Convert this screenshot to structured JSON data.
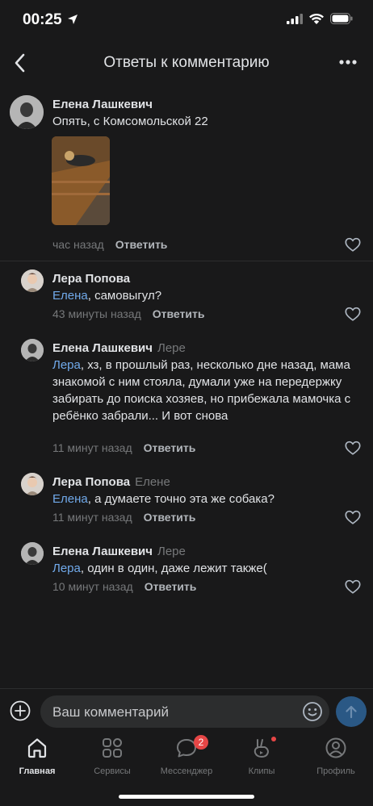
{
  "status": {
    "time": "00:25"
  },
  "nav": {
    "title": "Ответы к комментарию",
    "back_icon": "chevron-left-icon",
    "more_icon": "more-horizontal-icon"
  },
  "root_comment": {
    "author": "Елена Лашкевич",
    "text": "Опять, с Комсомольской 22",
    "time": "час назад",
    "reply_label": "Ответить"
  },
  "replies": [
    {
      "author": "Лера Попова",
      "reply_to": "",
      "mention": "Елена",
      "text": ", самовыгул?",
      "time": "43 минуты назад",
      "reply_label": "Ответить"
    },
    {
      "author": "Елена Лашкевич",
      "reply_to": "Лере",
      "mention": "Лера",
      "text": ", хз, в прошлый раз, несколько дне назад, мама знакомой с ним стояла, думали уже на передержку забирать до поиска хозяев, но прибежала мамочка с ребёнко забрали... И вот снова",
      "time": "11 минут назад",
      "reply_label": "Ответить"
    },
    {
      "author": "Лера Попова",
      "reply_to": "Елене",
      "mention": "Елена",
      "text": ", а думаете точно эта же собака?",
      "time": "11 минут назад",
      "reply_label": "Ответить"
    },
    {
      "author": "Елена Лашкевич",
      "reply_to": "Лере",
      "mention": "Лера",
      "text": ", один в один, даже лежит также(",
      "time": "10 минут назад",
      "reply_label": "Ответить"
    }
  ],
  "composer": {
    "placeholder": "Ваш комментарий"
  },
  "tabs": [
    {
      "label": "Главная",
      "icon": "home-icon"
    },
    {
      "label": "Сервисы",
      "icon": "services-grid-icon"
    },
    {
      "label": "Мессенджер",
      "icon": "messenger-icon",
      "badge": "2"
    },
    {
      "label": "Клипы",
      "icon": "clips-icon"
    },
    {
      "label": "Профиль",
      "icon": "profile-icon"
    }
  ],
  "colors": {
    "background": "#19191a",
    "accent": "#71aaeb",
    "badge": "#e64646",
    "send": "#2a5885"
  }
}
